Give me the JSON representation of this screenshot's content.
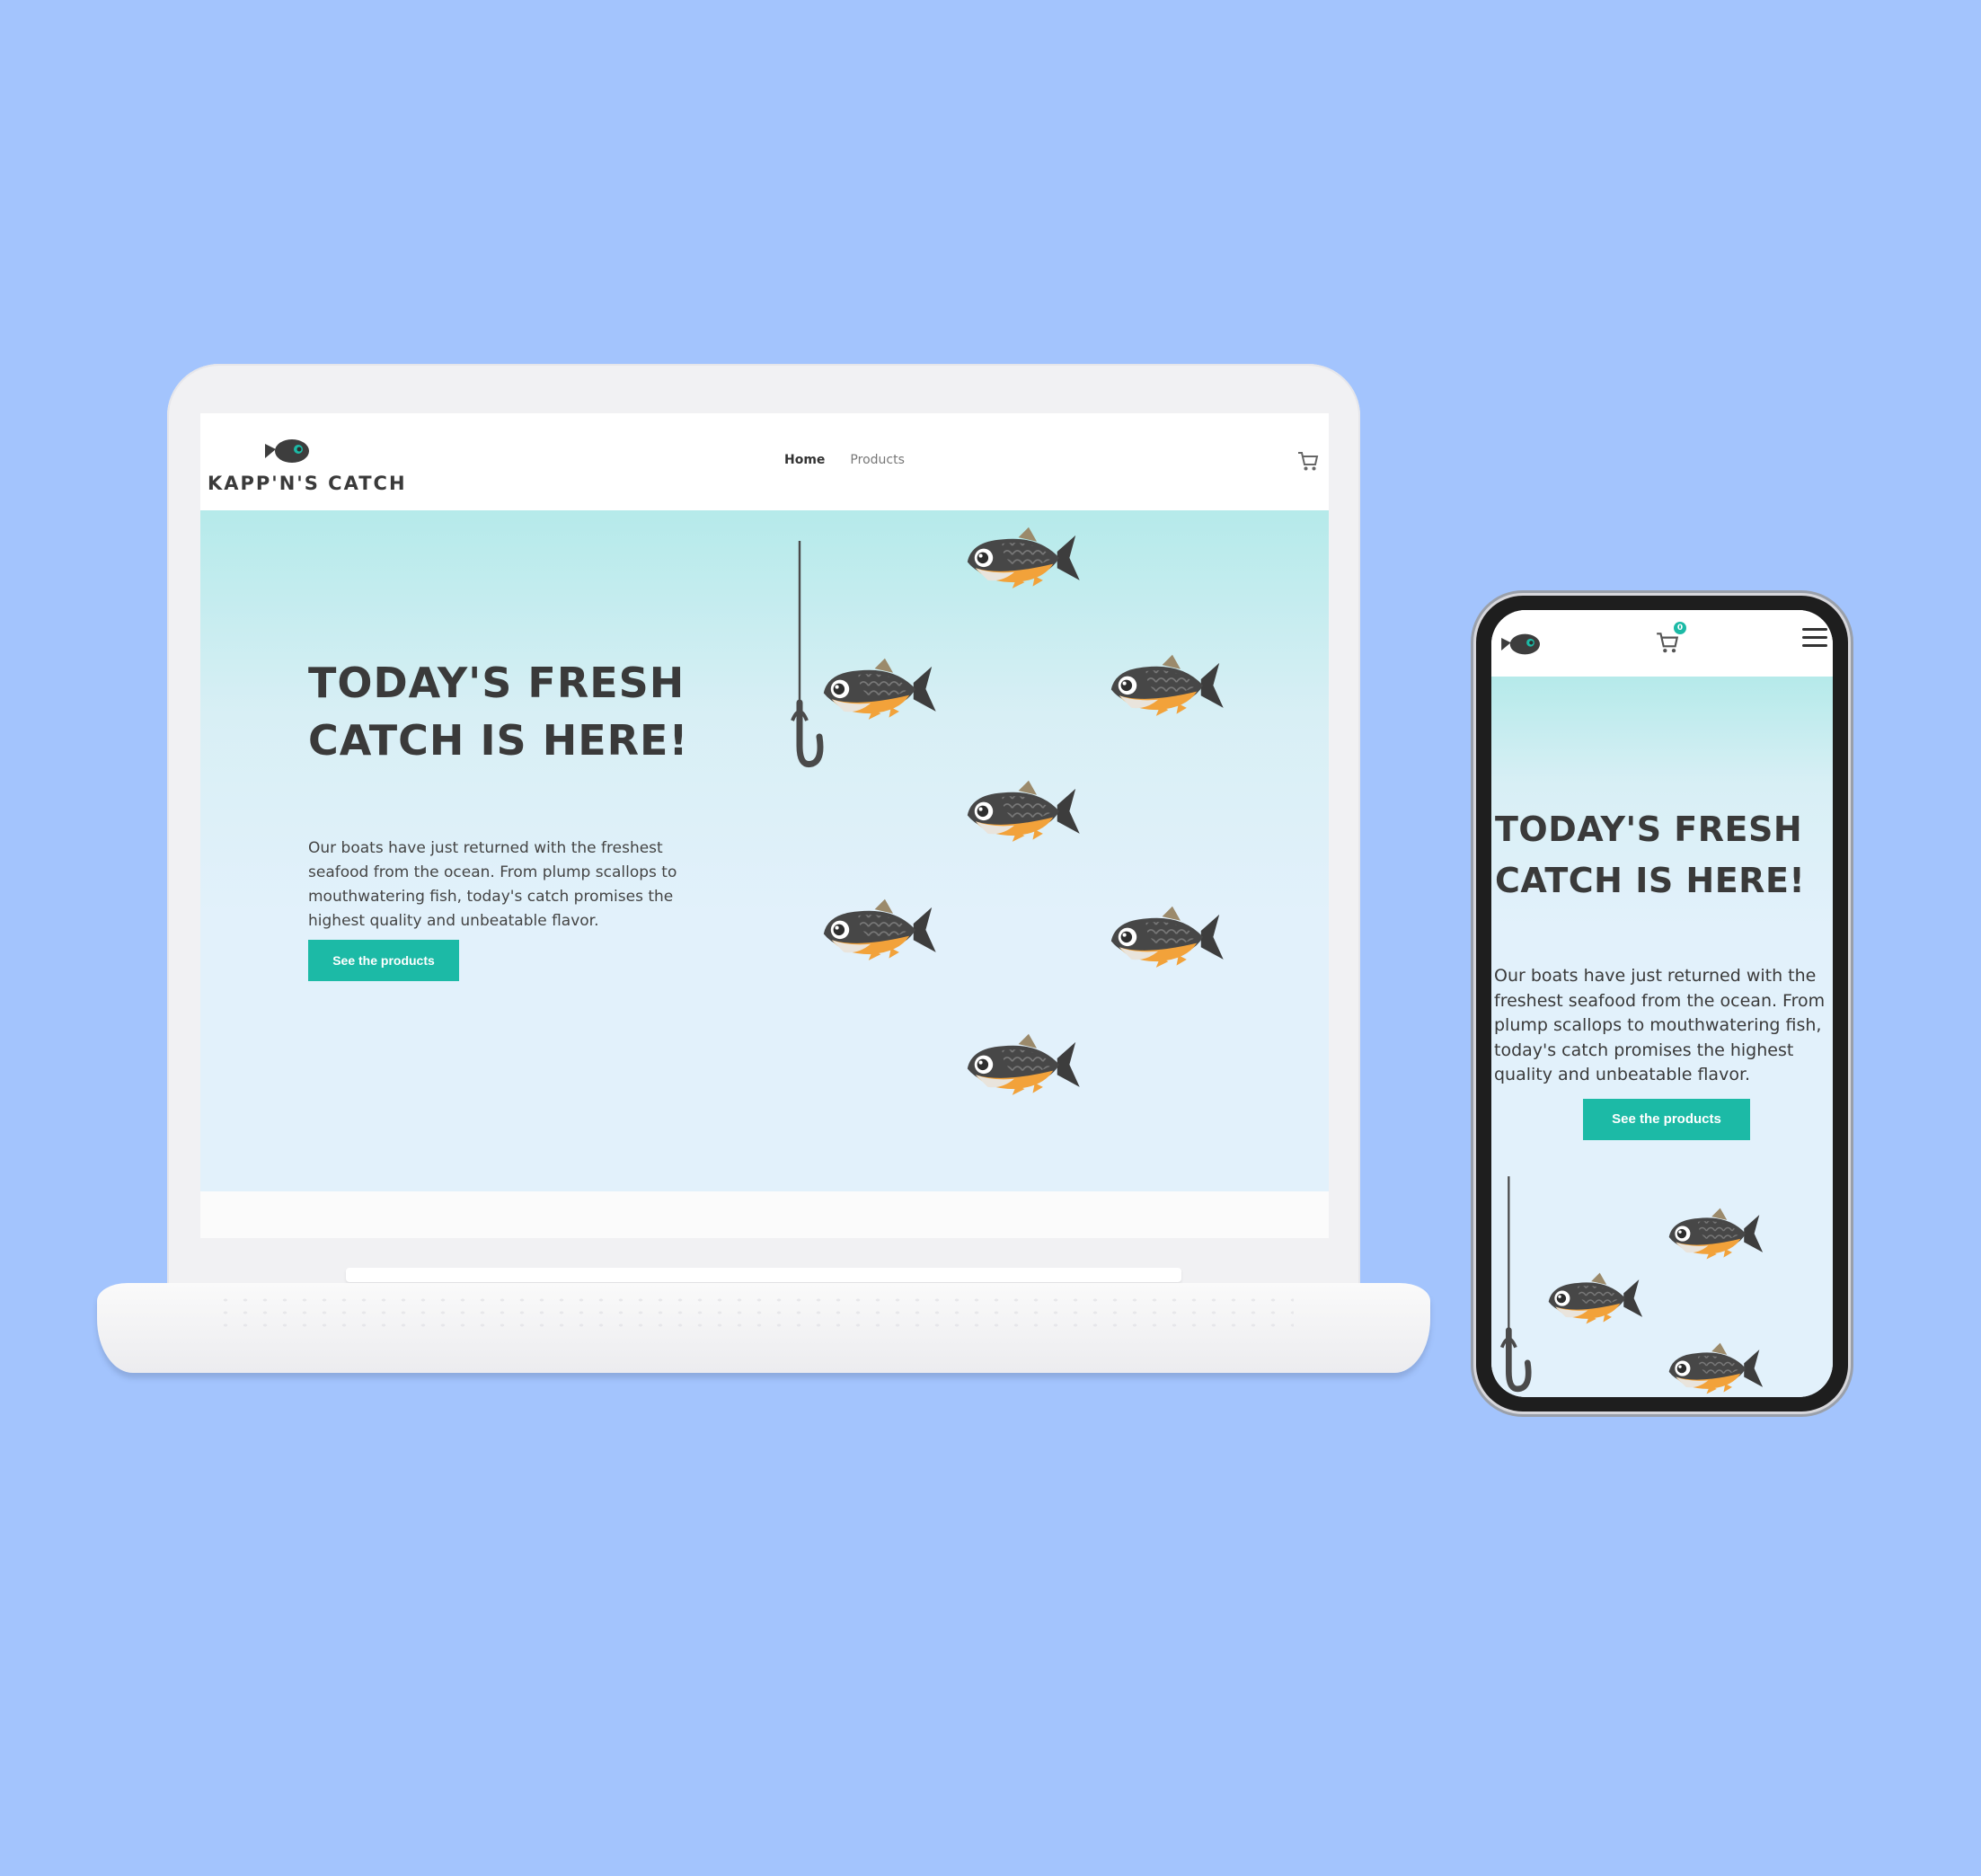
{
  "brand": {
    "name": "KAPP'N'S CATCH",
    "accent_color": "#1cbaa6",
    "background_color": "#a3c4fd",
    "logo_icon": "fish-logo-icon"
  },
  "desktop": {
    "nav": {
      "home_label": "Home",
      "products_label": "Products"
    },
    "cart_icon": "cart-icon",
    "hero": {
      "title": "TODAY'S FRESH CATCH IS HERE!",
      "description": "Our boats have just returned with the freshest seafood from the ocean. From plump scallops to mouthwatering fish, today's catch promises the highest quality and unbeatable flavor.",
      "cta_label": "See the products"
    }
  },
  "mobile": {
    "cart_icon": "cart-icon",
    "cart_count": "0",
    "menu_icon": "hamburger-menu-icon",
    "hero": {
      "title": "TODAY'S FRESH CATCH IS HERE!",
      "description": "Our boats have just returned with the freshest seafood from the ocean. From plump scallops to mouthwatering fish, today's catch promises the highest quality and unbeatable flavor.",
      "cta_label": "See the products"
    }
  }
}
